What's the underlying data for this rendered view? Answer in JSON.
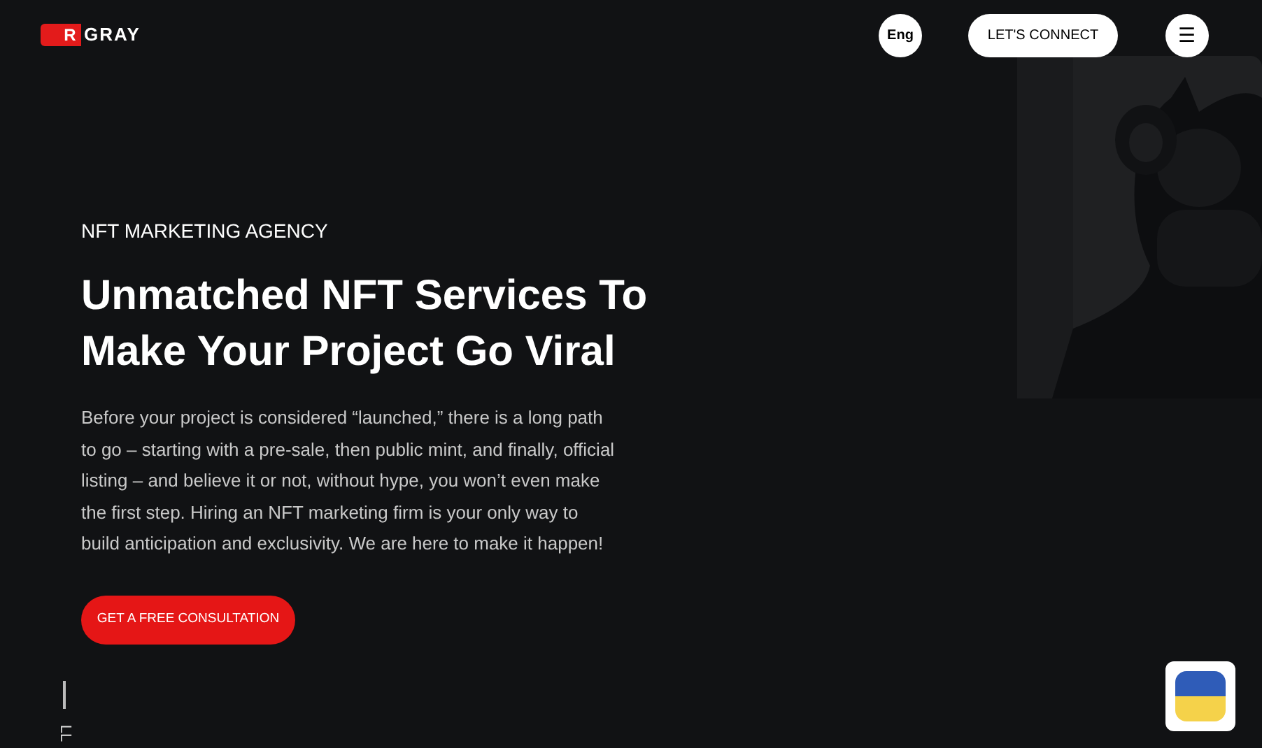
{
  "header": {
    "logo": {
      "mark": "R",
      "word": "GRAY"
    },
    "language": "Eng",
    "connect_button": "LET'S CONNECT",
    "menu_button": "☰"
  },
  "hero": {
    "eyebrow": "NFT MARKETING AGENCY",
    "title": "Unmatched NFT Services To Make Your Project Go Viral",
    "body": "Before your project is considered “launched,” there is a long path to go – starting with a pre-sale, then public mint, and finally, official listing – and believe it or not, without hype, you won’t even make the first step. Hiring an NFT marketing firm is your only way to build anticipation and exclusivity. We are here to make it happen!",
    "cta": "GET A FREE CONSULTATION"
  },
  "scroll_hint": "LL"
}
